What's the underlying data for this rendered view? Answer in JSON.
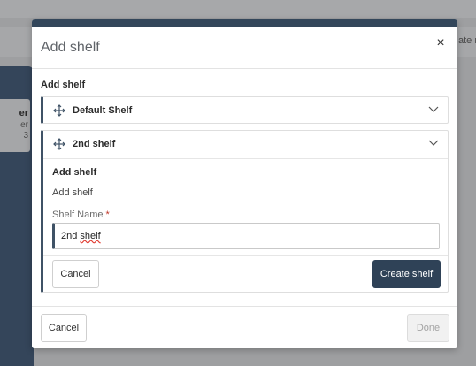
{
  "background": {
    "side_text": "ate n",
    "card": {
      "line1": "er",
      "line2": "er",
      "line3": "3"
    }
  },
  "modal": {
    "title": "Add shelf",
    "close_icon": "×",
    "section_title": "Add shelf",
    "shelves": [
      {
        "label": "Default Shelf",
        "expanded": false
      },
      {
        "label": "2nd shelf",
        "expanded": true
      }
    ],
    "form": {
      "title": "Add shelf",
      "subtitle": "Add shelf",
      "field_label": "Shelf Name",
      "required_mark": "*",
      "value_prefix": "2nd ",
      "value_spell": "shelf",
      "cancel_label": "Cancel",
      "create_label": "Create shelf"
    },
    "footer": {
      "cancel_label": "Cancel",
      "done_label": "Done"
    }
  },
  "colors": {
    "primary": "#2f4257",
    "annotation_arrow": "#e8822a",
    "required": "#c0392b"
  },
  "icons": [
    "close-icon",
    "drag-handle-icon",
    "chevron-down-icon"
  ]
}
